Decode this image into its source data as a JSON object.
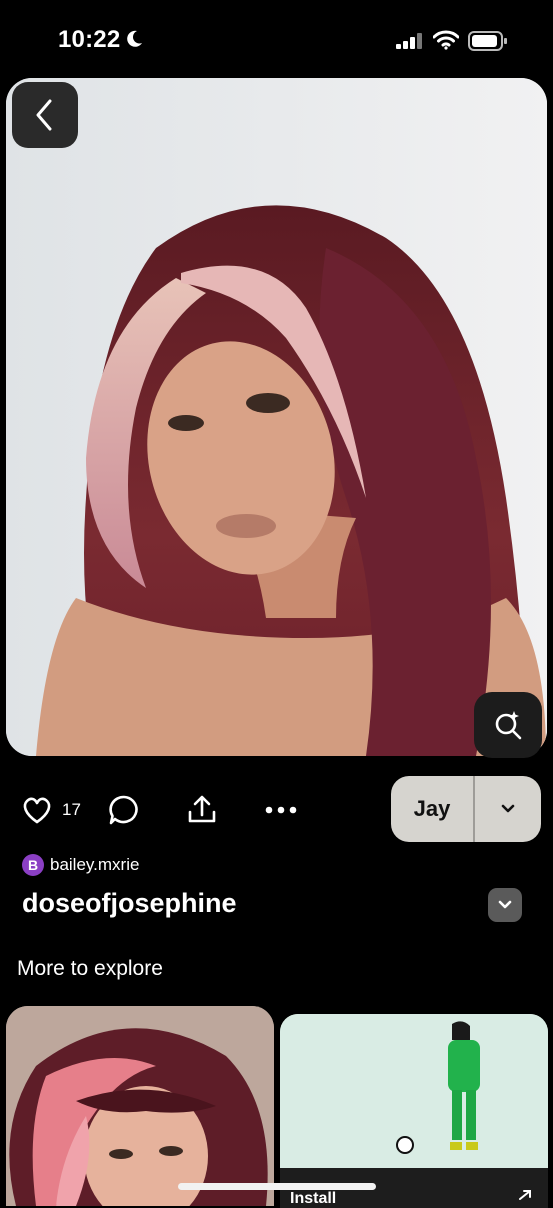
{
  "status_bar": {
    "time": "10:22"
  },
  "pin": {
    "image_icon": "portrait-photo",
    "lens_icon": "visual-search-icon"
  },
  "actions": {
    "like_count": "17",
    "save_board_label": "Jay"
  },
  "author": {
    "avatar_initial": "B",
    "uploader": "bailey.mxrie",
    "board_title": "doseofjosephine"
  },
  "explore": {
    "title": "More to explore"
  },
  "feed": {
    "card2_cta": "Install"
  },
  "colors": {
    "accent_avatar": "#8b3fc4",
    "save_button_bg": "#d6d4cf"
  }
}
